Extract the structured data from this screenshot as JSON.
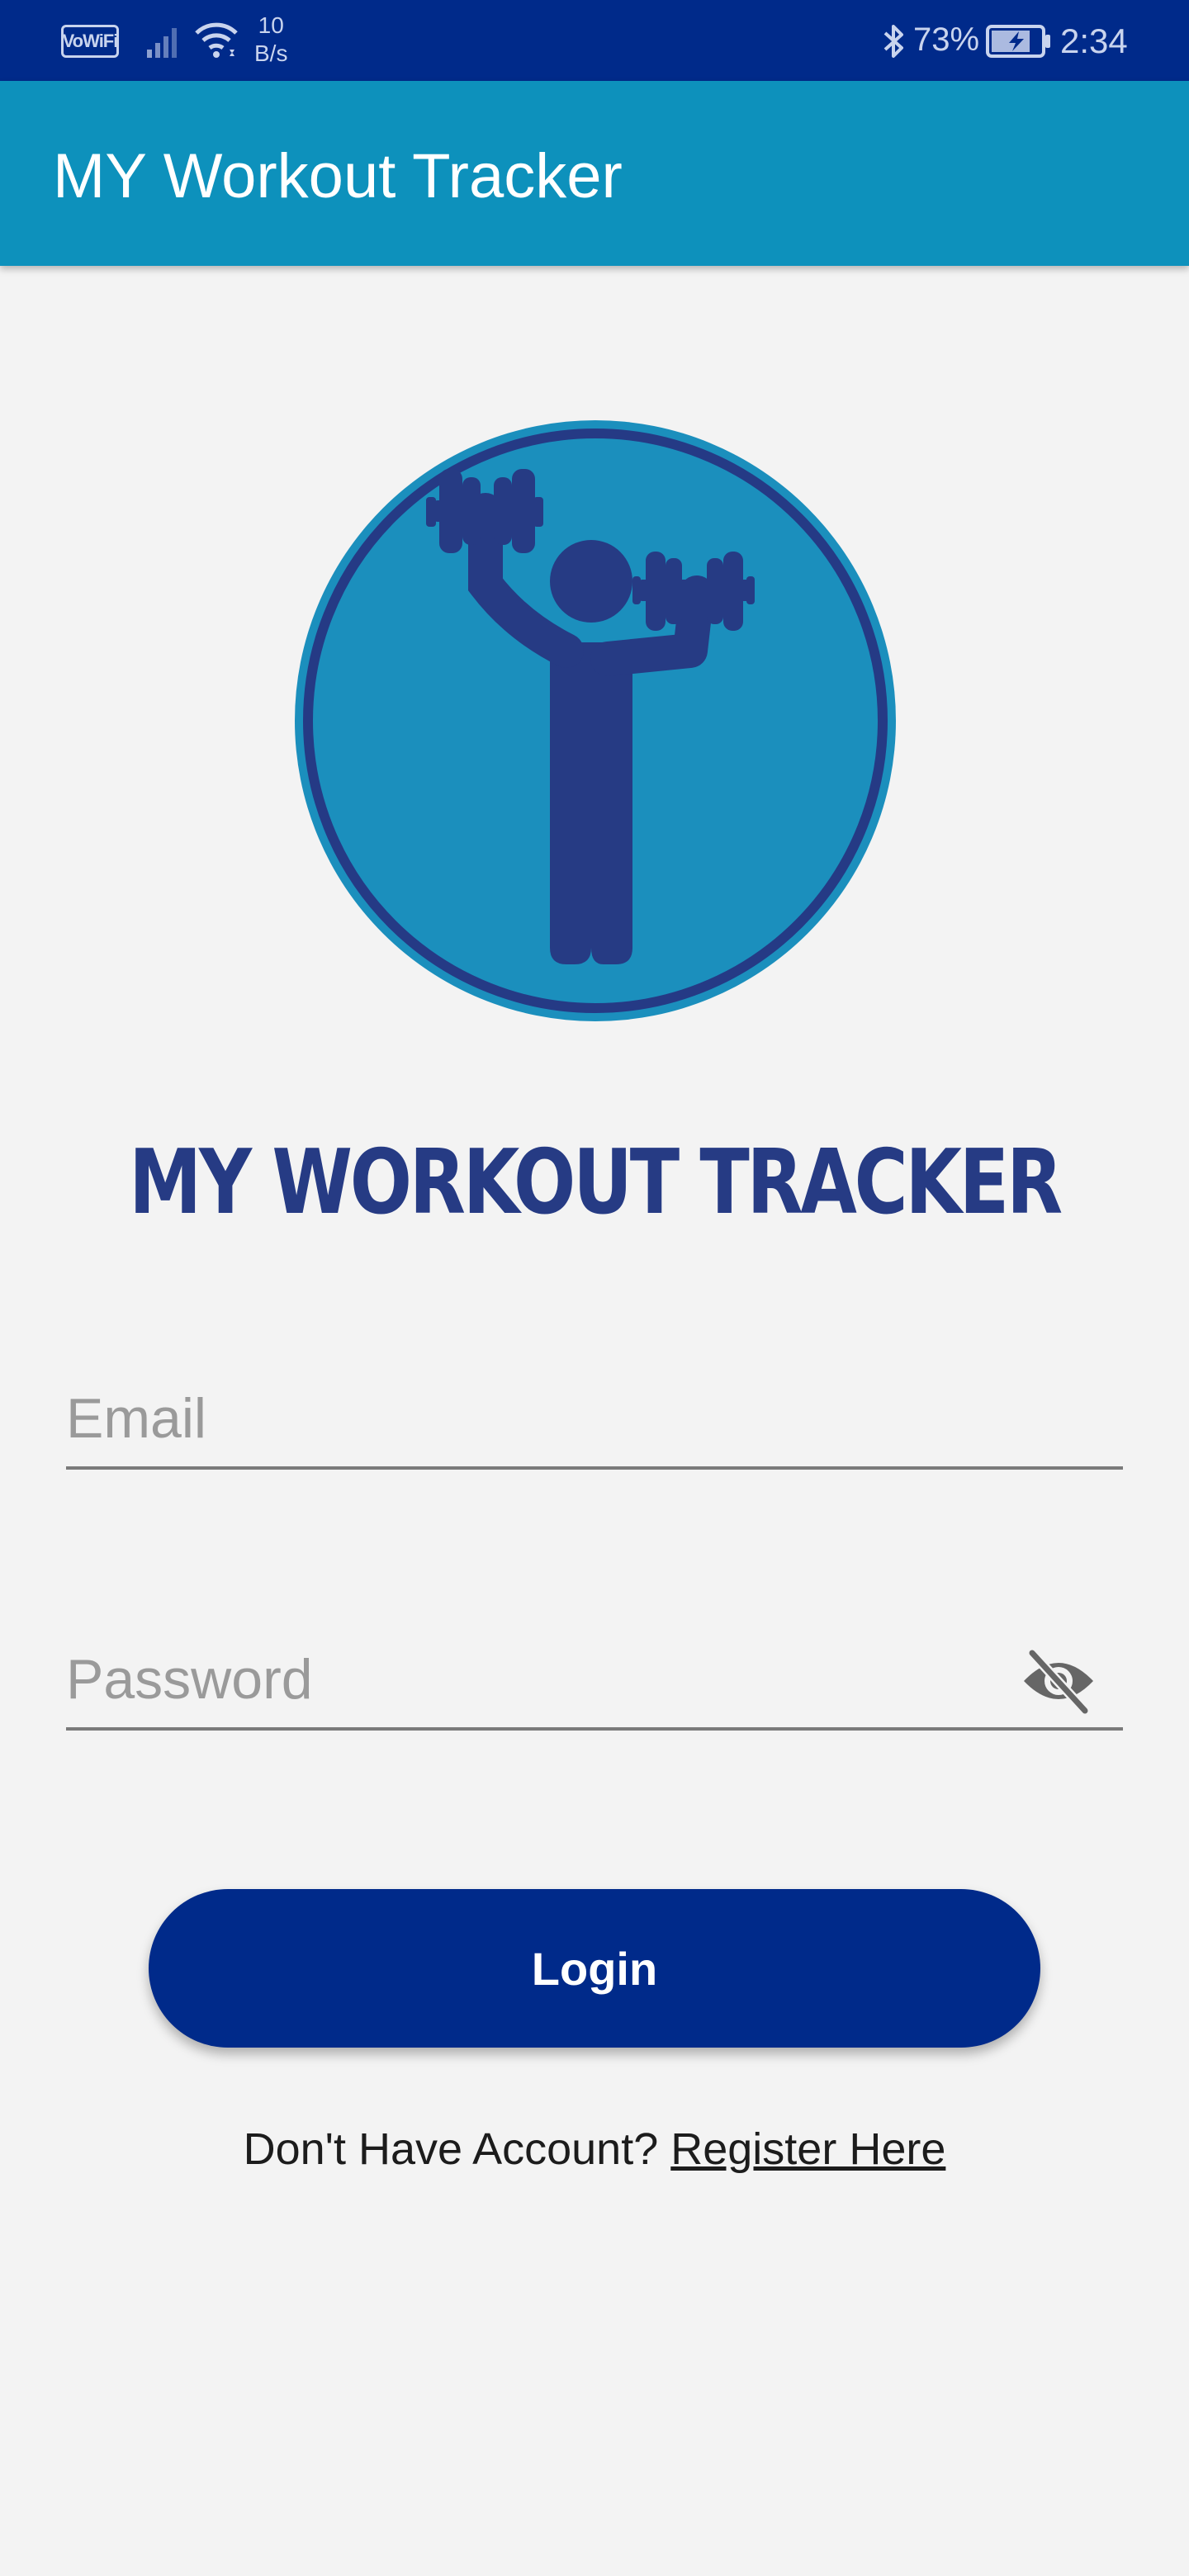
{
  "status_bar": {
    "wifi_calling_label": "VoWiFi",
    "net_speed_value": "10",
    "net_speed_unit": "B/s",
    "battery_percent": "73%",
    "clock": "2:34",
    "icons": [
      "signal-icon",
      "wifi-icon",
      "bluetooth-icon",
      "battery-charging-icon"
    ]
  },
  "app_bar": {
    "title": "MY Workout Tracker"
  },
  "logo": {
    "icon": "dumbbell-lifter-icon",
    "colors": {
      "fill": "#1b8fbd",
      "ring": "#253a85",
      "figure": "#263b84"
    }
  },
  "brand_title": "MY WORKOUT TRACKER",
  "form": {
    "email_placeholder": "Email",
    "password_placeholder": "Password",
    "password_toggle_icon": "eye-off-icon",
    "login_label": "Login",
    "register_prompt": "Don't Have Account?",
    "register_link": "Register Here"
  },
  "colors": {
    "status_bar": "#002a8a",
    "app_bar": "#0d91bc",
    "button": "#002a8a",
    "background": "#f3f3f3"
  }
}
